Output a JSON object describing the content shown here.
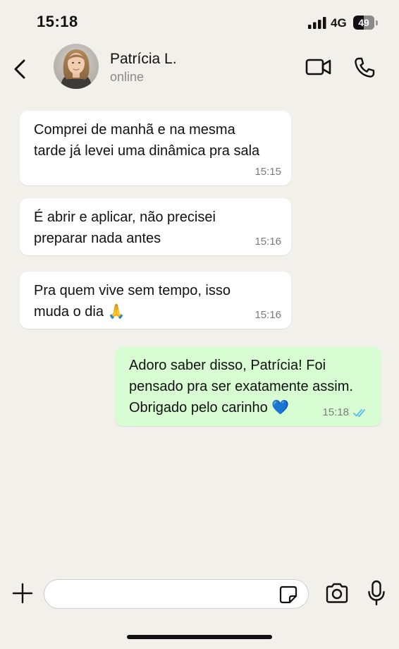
{
  "status_bar": {
    "time": "15:18",
    "network": "4G",
    "battery_level": "49",
    "battery_fraction": 0.49
  },
  "header": {
    "contact_name": "Patrícia L.",
    "contact_status": "online",
    "icons": {
      "back": "chevron-left-icon",
      "video": "video-camera-icon",
      "call": "phone-icon"
    }
  },
  "messages": [
    {
      "direction": "incoming",
      "text": "Comprei de manhã e na mesma\ntarde já levei uma dinâmica pra sala",
      "time": "15:15"
    },
    {
      "direction": "incoming",
      "text": "É abrir e aplicar, não precisei\npreparar nada antes",
      "time": "15:16"
    },
    {
      "direction": "incoming",
      "text": "Pra quem vive sem tempo, isso\nmuda o dia 🙏",
      "time": "15:16"
    },
    {
      "direction": "outgoing",
      "text": "Adoro saber disso, Patrícia! Foi\npensado pra ser exatamente assim.\nObrigado pelo carinho 💙",
      "time": "15:18",
      "read": true
    }
  ],
  "composer": {
    "input_value": "",
    "icons": {
      "plus": "plus-icon",
      "sticker": "sticker-icon",
      "camera": "camera-icon",
      "mic": "microphone-icon"
    }
  },
  "colors": {
    "background": "#f2f0ea",
    "incoming_bubble": "#ffffff",
    "outgoing_bubble": "#d9fdd3",
    "read_ticks": "#53bdeb",
    "meta_text": "#7b7b7b"
  }
}
